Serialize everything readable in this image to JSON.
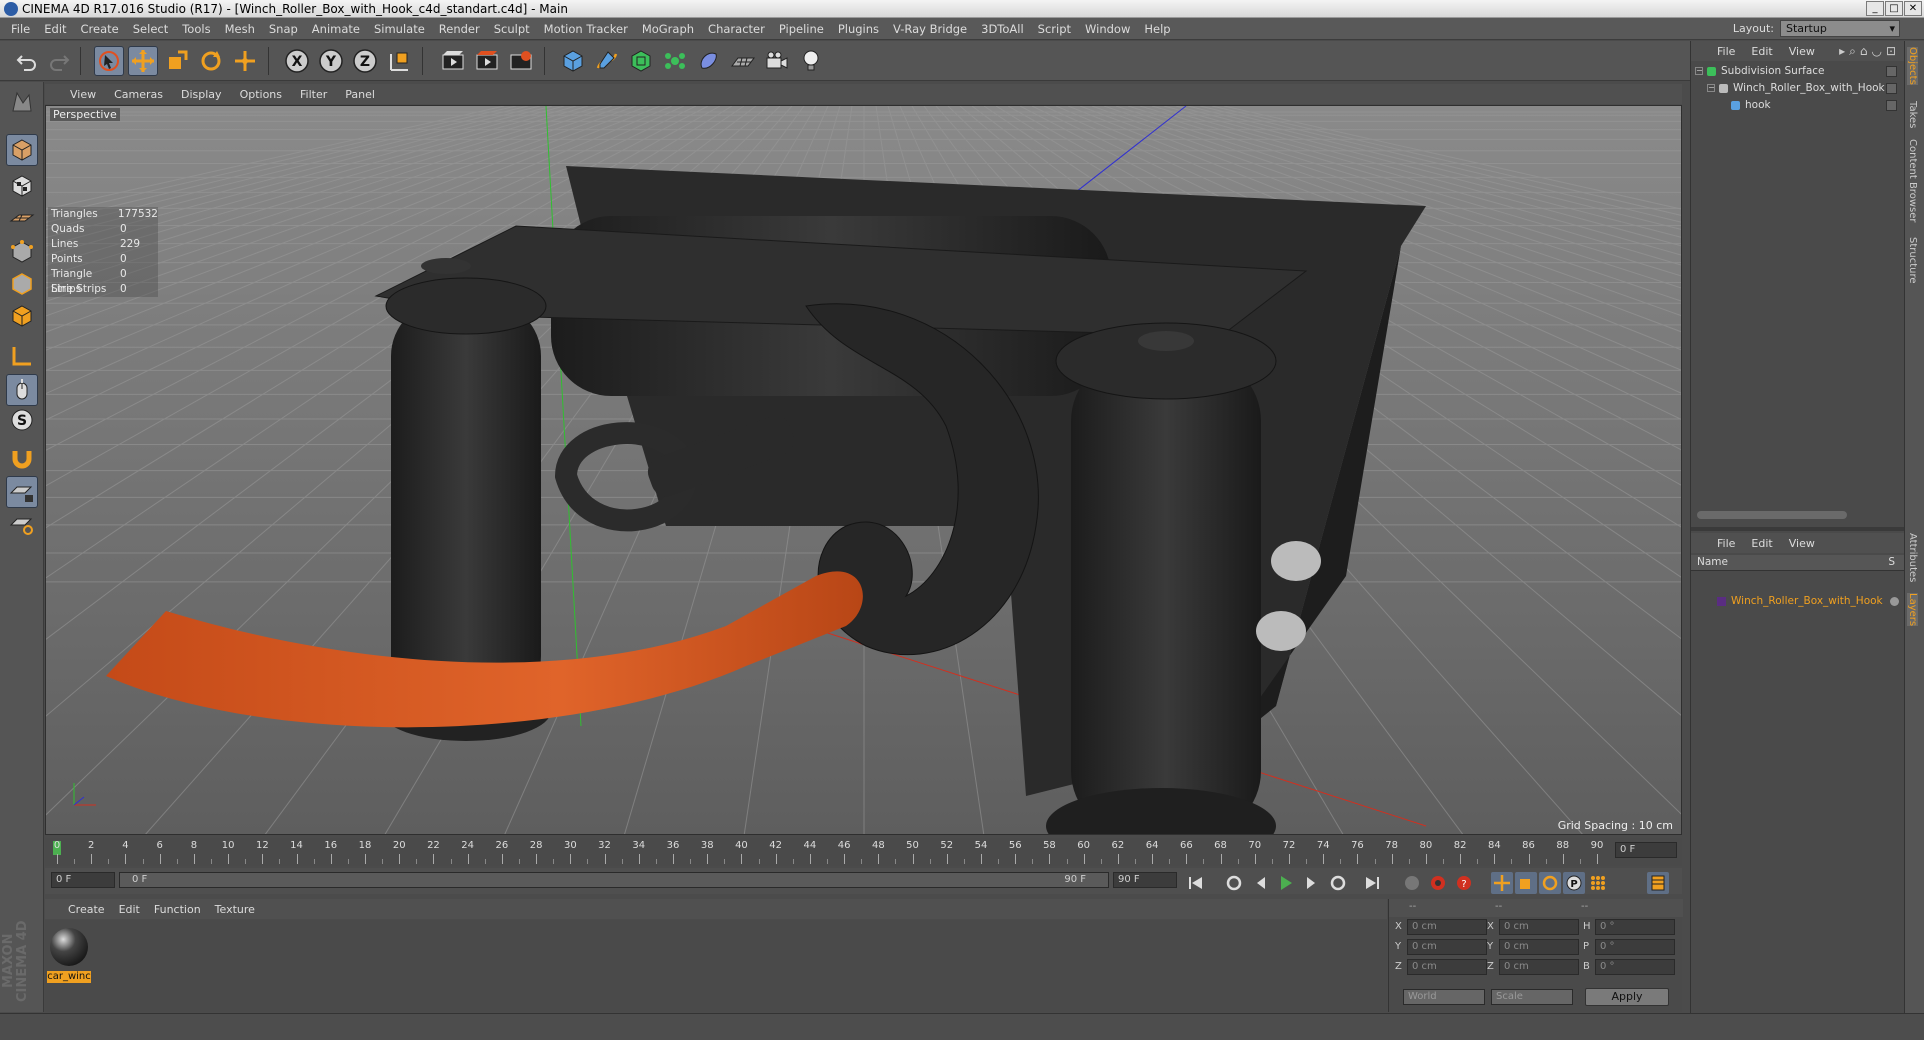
{
  "window": {
    "title": "CINEMA 4D R17.016 Studio (R17) - [Winch_Roller_Box_with_Hook_c4d_standart.c4d] - Main"
  },
  "menubar": [
    "File",
    "Edit",
    "Create",
    "Select",
    "Tools",
    "Mesh",
    "Snap",
    "Animate",
    "Simulate",
    "Render",
    "Sculpt",
    "Motion Tracker",
    "MoGraph",
    "Character",
    "Pipeline",
    "Plugins",
    "V-Ray Bridge",
    "3DToAll",
    "Script",
    "Window",
    "Help"
  ],
  "layout": {
    "label": "Layout:",
    "value": "Startup"
  },
  "viewport": {
    "menu": [
      "View",
      "Cameras",
      "Display",
      "Options",
      "Filter",
      "Panel"
    ],
    "label": "Perspective",
    "grid_spacing": "Grid Spacing : 10 cm",
    "stats": [
      {
        "k": "Triangles",
        "v": "177532"
      },
      {
        "k": "Quads",
        "v": "0"
      },
      {
        "k": "Lines",
        "v": "229"
      },
      {
        "k": "Points",
        "v": "0"
      },
      {
        "k": "Triangle Strips",
        "v": "0"
      },
      {
        "k": "Line Strips",
        "v": "0"
      }
    ]
  },
  "timeline": {
    "ticks": [
      "0",
      "2",
      "4",
      "6",
      "8",
      "10",
      "12",
      "14",
      "16",
      "18",
      "20",
      "22",
      "24",
      "26",
      "28",
      "30",
      "32",
      "34",
      "36",
      "38",
      "40",
      "42",
      "44",
      "46",
      "48",
      "50",
      "52",
      "54",
      "56",
      "58",
      "60",
      "62",
      "64",
      "66",
      "68",
      "70",
      "72",
      "74",
      "76",
      "78",
      "80",
      "82",
      "84",
      "86",
      "88",
      "90"
    ],
    "current_frame": "0 F",
    "start": "0 F",
    "range_start": "0 F",
    "range_end": "90 F",
    "end": "90 F"
  },
  "material": {
    "menu": [
      "Create",
      "Edit",
      "Function",
      "Texture"
    ],
    "items": [
      {
        "name": "car_winc"
      }
    ]
  },
  "coords": {
    "header": [
      "--",
      "--",
      "--"
    ],
    "rows": [
      {
        "a": "X",
        "av": "0 cm",
        "b": "X",
        "bv": "0 cm",
        "c": "H",
        "cv": "0 °"
      },
      {
        "a": "Y",
        "av": "0 cm",
        "b": "Y",
        "bv": "0 cm",
        "c": "P",
        "cv": "0 °"
      },
      {
        "a": "Z",
        "av": "0 cm",
        "b": "Z",
        "bv": "0 cm",
        "c": "B",
        "cv": "0 °"
      }
    ],
    "world": "World",
    "scale": "Scale",
    "apply": "Apply"
  },
  "objects": {
    "menu": [
      "File",
      "Edit",
      "View"
    ],
    "tree": [
      {
        "name": "Subdivision Surface",
        "depth": 0
      },
      {
        "name": "Winch_Roller_Box_with_Hook",
        "depth": 1
      },
      {
        "name": "hook",
        "depth": 2
      }
    ]
  },
  "layers": {
    "menu": [
      "File",
      "Edit",
      "View"
    ],
    "col_name": "Name",
    "col_s": "S",
    "items": [
      {
        "name": "Winch_Roller_Box_with_Hook"
      }
    ]
  },
  "side_tabs": [
    "Objects",
    "Takes",
    "Content Browser",
    "Structure"
  ],
  "side_tabs2": [
    "Attributes",
    "Layers"
  ],
  "colors": {
    "accent": "#7b8aa0",
    "strap": "#d4551f",
    "selected_text": "#f0a020"
  }
}
